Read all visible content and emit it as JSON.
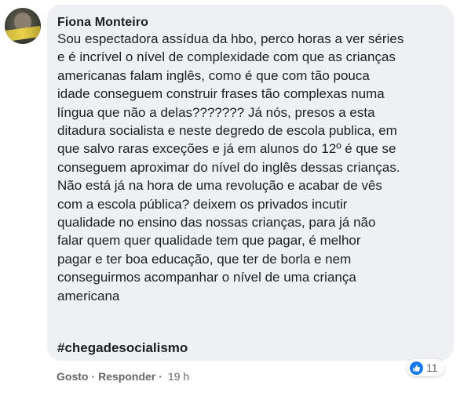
{
  "comment": {
    "author": "Fiona Monteiro",
    "body_lines": [
      "Sou espectadora assídua da hbo, perco horas a ver séries",
      "e é incrível o nível de complexidade com que as crianças",
      "americanas falam inglês, como é que com tão pouca",
      "idade conseguem construir frases tão complexas numa",
      "língua que não a delas??????? Já nós, presos a esta",
      "ditadura socialista e neste degredo de escola publica, em",
      "que salvo raras exceções e já em alunos do 12º é que se",
      "conseguem aproximar do nível do inglês dessas crianças.",
      "Não está já na hora de uma revolução e acabar de vês",
      "com a escola pública? deixem os privados incutir",
      "qualidade no ensino das nossas crianças, para já não",
      "falar quem quer qualidade tem que pagar, é melhor",
      "pagar e ter boa educação, que ter de borla e nem",
      "conseguirmos acompanhar o nível de uma criança",
      "americana"
    ],
    "hashtag": "#chegadesocialismo",
    "reactions": {
      "icon": "like-icon",
      "count": "11",
      "color": "#1877f2"
    }
  },
  "actions": {
    "like_label": "Gosto",
    "separator": "·",
    "reply_label": "Responder",
    "time_separator": "·",
    "timestamp": "19 h"
  },
  "colors": {
    "bubble": "#eef0f3",
    "text": "#1c1e21",
    "muted": "#65676b",
    "like_blue": "#1877f2"
  }
}
